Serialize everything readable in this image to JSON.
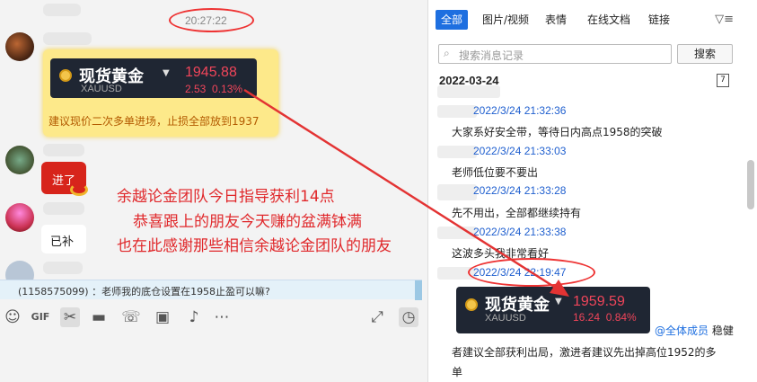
{
  "chat": {
    "timestamp": "20:27:22",
    "gold_card": {
      "name": "现货黄金",
      "code": "XAUUSD",
      "price": "1945.88",
      "change": "2.53",
      "change_pct": "0.13%",
      "advice": "建议现价二次多单进场，止损全部放到1937"
    },
    "messages": [
      {
        "text": "进了"
      },
      {
        "text": "已补"
      }
    ],
    "promo_lines": [
      "余越论金团队今日指导获利14点",
      "恭喜跟上的朋友今天赚的盆满钵满",
      "也在此感谢那些相信余越论金团队的朋友"
    ],
    "notice": "(1158575099) ：老师我的底仓设置在1958止盈可以嘛?",
    "toolbar_icons": [
      "emoji-icon",
      "gif-icon",
      "scissors-icon",
      "folder-icon",
      "phone-icon",
      "image-icon",
      "bell-icon",
      "more-icon",
      "expand-icon",
      "history-icon"
    ],
    "toolbar_glyphs": {
      "gif": "GIF"
    }
  },
  "history": {
    "tabs": [
      "全部",
      "图片/视频",
      "表情",
      "在线文档",
      "链接"
    ],
    "active_tab": "全部",
    "search": {
      "placeholder": "搜索消息记录",
      "button": "搜索"
    },
    "date": "2022-03-24",
    "calendar_day": "7",
    "messages": [
      {
        "time": "2022/3/24 21:32:36",
        "text": "大家系好安全带，等待日内高点1958的突破"
      },
      {
        "time": "2022/3/24 21:33:03",
        "text": "老师低位要不要出"
      },
      {
        "time": "2022/3/24 21:33:28",
        "text": "先不用出，全部都继续持有"
      },
      {
        "time": "2022/3/24 21:33:38",
        "text": "这波多头我非常看好"
      },
      {
        "time": "2022/3/24 22:19:47",
        "text": ""
      }
    ],
    "gold_card": {
      "name": "现货黄金",
      "code": "XAUUSD",
      "price": "1959.59",
      "change": "16.24",
      "change_pct": "0.84%"
    },
    "mention_at": "@全体成员",
    "mention_text": " 稳健",
    "final_lines": [
      "者建议全部获利出局，激进者建议先出掉高位1952的多",
      "单"
    ]
  },
  "colors": {
    "accent": "#1e6fe0",
    "annotation": "#e33333",
    "price_red": "#f0455a",
    "card_bg": "#1f2633",
    "highlight": "#fde98a"
  }
}
